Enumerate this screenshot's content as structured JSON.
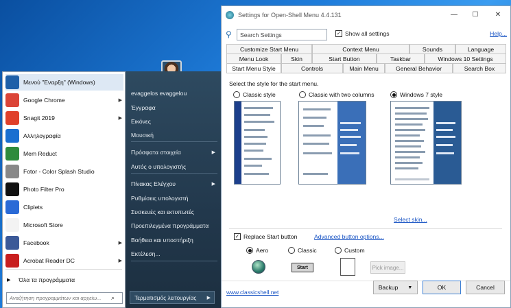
{
  "start_menu": {
    "programs": [
      {
        "label": "Μενού \"Εναρξη\" (Windows)",
        "icon": "windows-start-icon",
        "color": "#1e5fa8",
        "arrow": false
      },
      {
        "label": "Google Chrome",
        "icon": "chrome-icon",
        "color": "#db4437",
        "arrow": true
      },
      {
        "label": "Snagit 2019",
        "icon": "snagit-icon",
        "color": "#e0402a",
        "arrow": true
      },
      {
        "label": "Αλληλογραφία",
        "icon": "mail-icon",
        "color": "#1a6fd0",
        "arrow": false
      },
      {
        "label": "Mem Reduct",
        "icon": "mem-reduct-icon",
        "color": "#2e8b3c",
        "arrow": false
      },
      {
        "label": "Fotor - Color Splash Studio",
        "icon": "fotor-icon",
        "color": "#888888",
        "arrow": false
      },
      {
        "label": "Photo Filter Pro",
        "icon": "photo-filter-icon",
        "color": "#111111",
        "arrow": false
      },
      {
        "label": "Cliplets",
        "icon": "cliplets-icon",
        "color": "#2a6ad6",
        "arrow": false
      },
      {
        "label": "Microsoft Store",
        "icon": "store-icon",
        "color": "#f3f3f3",
        "arrow": false
      },
      {
        "label": "Facebook",
        "icon": "facebook-icon",
        "color": "#3b5998",
        "arrow": true
      },
      {
        "label": "Acrobat Reader DC",
        "icon": "acrobat-icon",
        "color": "#c81e1e",
        "arrow": true
      }
    ],
    "all_programs": "Όλα τα προγράμματα",
    "search_placeholder": "Αναζήτηση προγραμμάτων και αρχείω...",
    "right_items": [
      {
        "label": "evaggelos evaggelou",
        "arrow": false
      },
      {
        "label": "Έγγραφα",
        "arrow": false
      },
      {
        "label": "Εικόνες",
        "arrow": false
      },
      {
        "label": "Μουσική",
        "arrow": false
      },
      {
        "label": "Πρόσφατα στοιχεία",
        "arrow": true
      },
      {
        "label": "Αυτός ο υπολογιστής",
        "arrow": false
      },
      {
        "label": "Πίνακας Ελέγχου",
        "arrow": true
      },
      {
        "label": "Ρυθμίσεις υπολογιστή",
        "arrow": false
      },
      {
        "label": "Συσκευές και εκτυπωτές",
        "arrow": false
      },
      {
        "label": "Προεπιλεγμένα προγράμματα",
        "arrow": false
      },
      {
        "label": "Βοήθεια και υποστήριξη",
        "arrow": false
      },
      {
        "label": "Εκτέλεση...",
        "arrow": false
      }
    ],
    "shutdown": "Τερματισμός λειτουργίας"
  },
  "settings": {
    "title": "Settings for Open-Shell Menu 4.4.131",
    "search_value": "Search Settings",
    "show_all": "Show all settings",
    "help": "Help...",
    "tabs_row1": [
      "Customize Start Menu",
      "Context Menu",
      "Sounds",
      "Language"
    ],
    "tabs_row2": [
      "Menu Look",
      "Skin",
      "Start Button",
      "Taskbar",
      "Windows 10 Settings"
    ],
    "tabs_row3": [
      "Start Menu Style",
      "Controls",
      "Main Menu",
      "General Behavior",
      "Search Box"
    ],
    "select_style_label": "Select the style for the start menu.",
    "styles": [
      {
        "label": "Classic style",
        "selected": false
      },
      {
        "label": "Classic with two columns",
        "selected": false
      },
      {
        "label": "Windows 7 style",
        "selected": true
      }
    ],
    "select_skin": "Select skin...",
    "replace_start": "Replace Start button",
    "advanced_options": "Advanced button options...",
    "button_styles": [
      {
        "label": "Aero",
        "selected": true
      },
      {
        "label": "Classic",
        "selected": false
      },
      {
        "label": "Custom",
        "selected": false
      }
    ],
    "classic_btn_text": "Start",
    "pick_image": "Pick image...",
    "homepage": "www.classicshell.net",
    "backup": "Backup",
    "ok": "OK",
    "cancel": "Cancel"
  }
}
